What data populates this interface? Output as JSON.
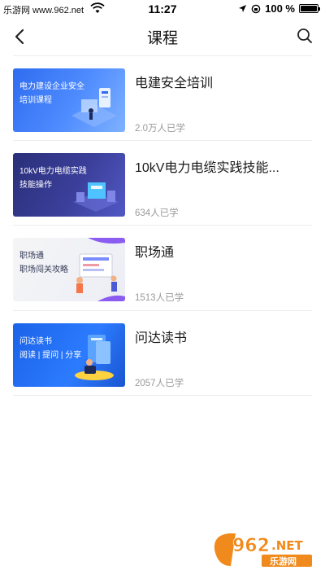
{
  "status_bar": {
    "left_text": "乐游网 www.962.net",
    "time": "11:27",
    "battery_text": "100 %",
    "battery_level": 1.0
  },
  "nav": {
    "title": "课程",
    "back_icon": "chevron-left-icon",
    "search_icon": "search-icon"
  },
  "courses": [
    {
      "thumb_text": "电力建设企业安全\n培训课程",
      "title": "电建安全培训",
      "count": "2.0万人已学"
    },
    {
      "thumb_text": "10kV电力电缆实践\n技能操作",
      "title": "10kV电力电缆实践技能...",
      "count": "634人已学"
    },
    {
      "thumb_text": "职场通\n职场闯关攻略",
      "title": "职场通",
      "count": "1513人已学"
    },
    {
      "thumb_text": "问达读书\n阅读 | 提问 | 分享",
      "title": "问达读书",
      "count": "2057人已学"
    }
  ],
  "watermark": {
    "top": "962.NET",
    "bottom": "乐游网"
  },
  "colors": {
    "divider": "#ececec",
    "muted_text": "#9a9a9a",
    "accent_blue": "#2f6cf0"
  }
}
